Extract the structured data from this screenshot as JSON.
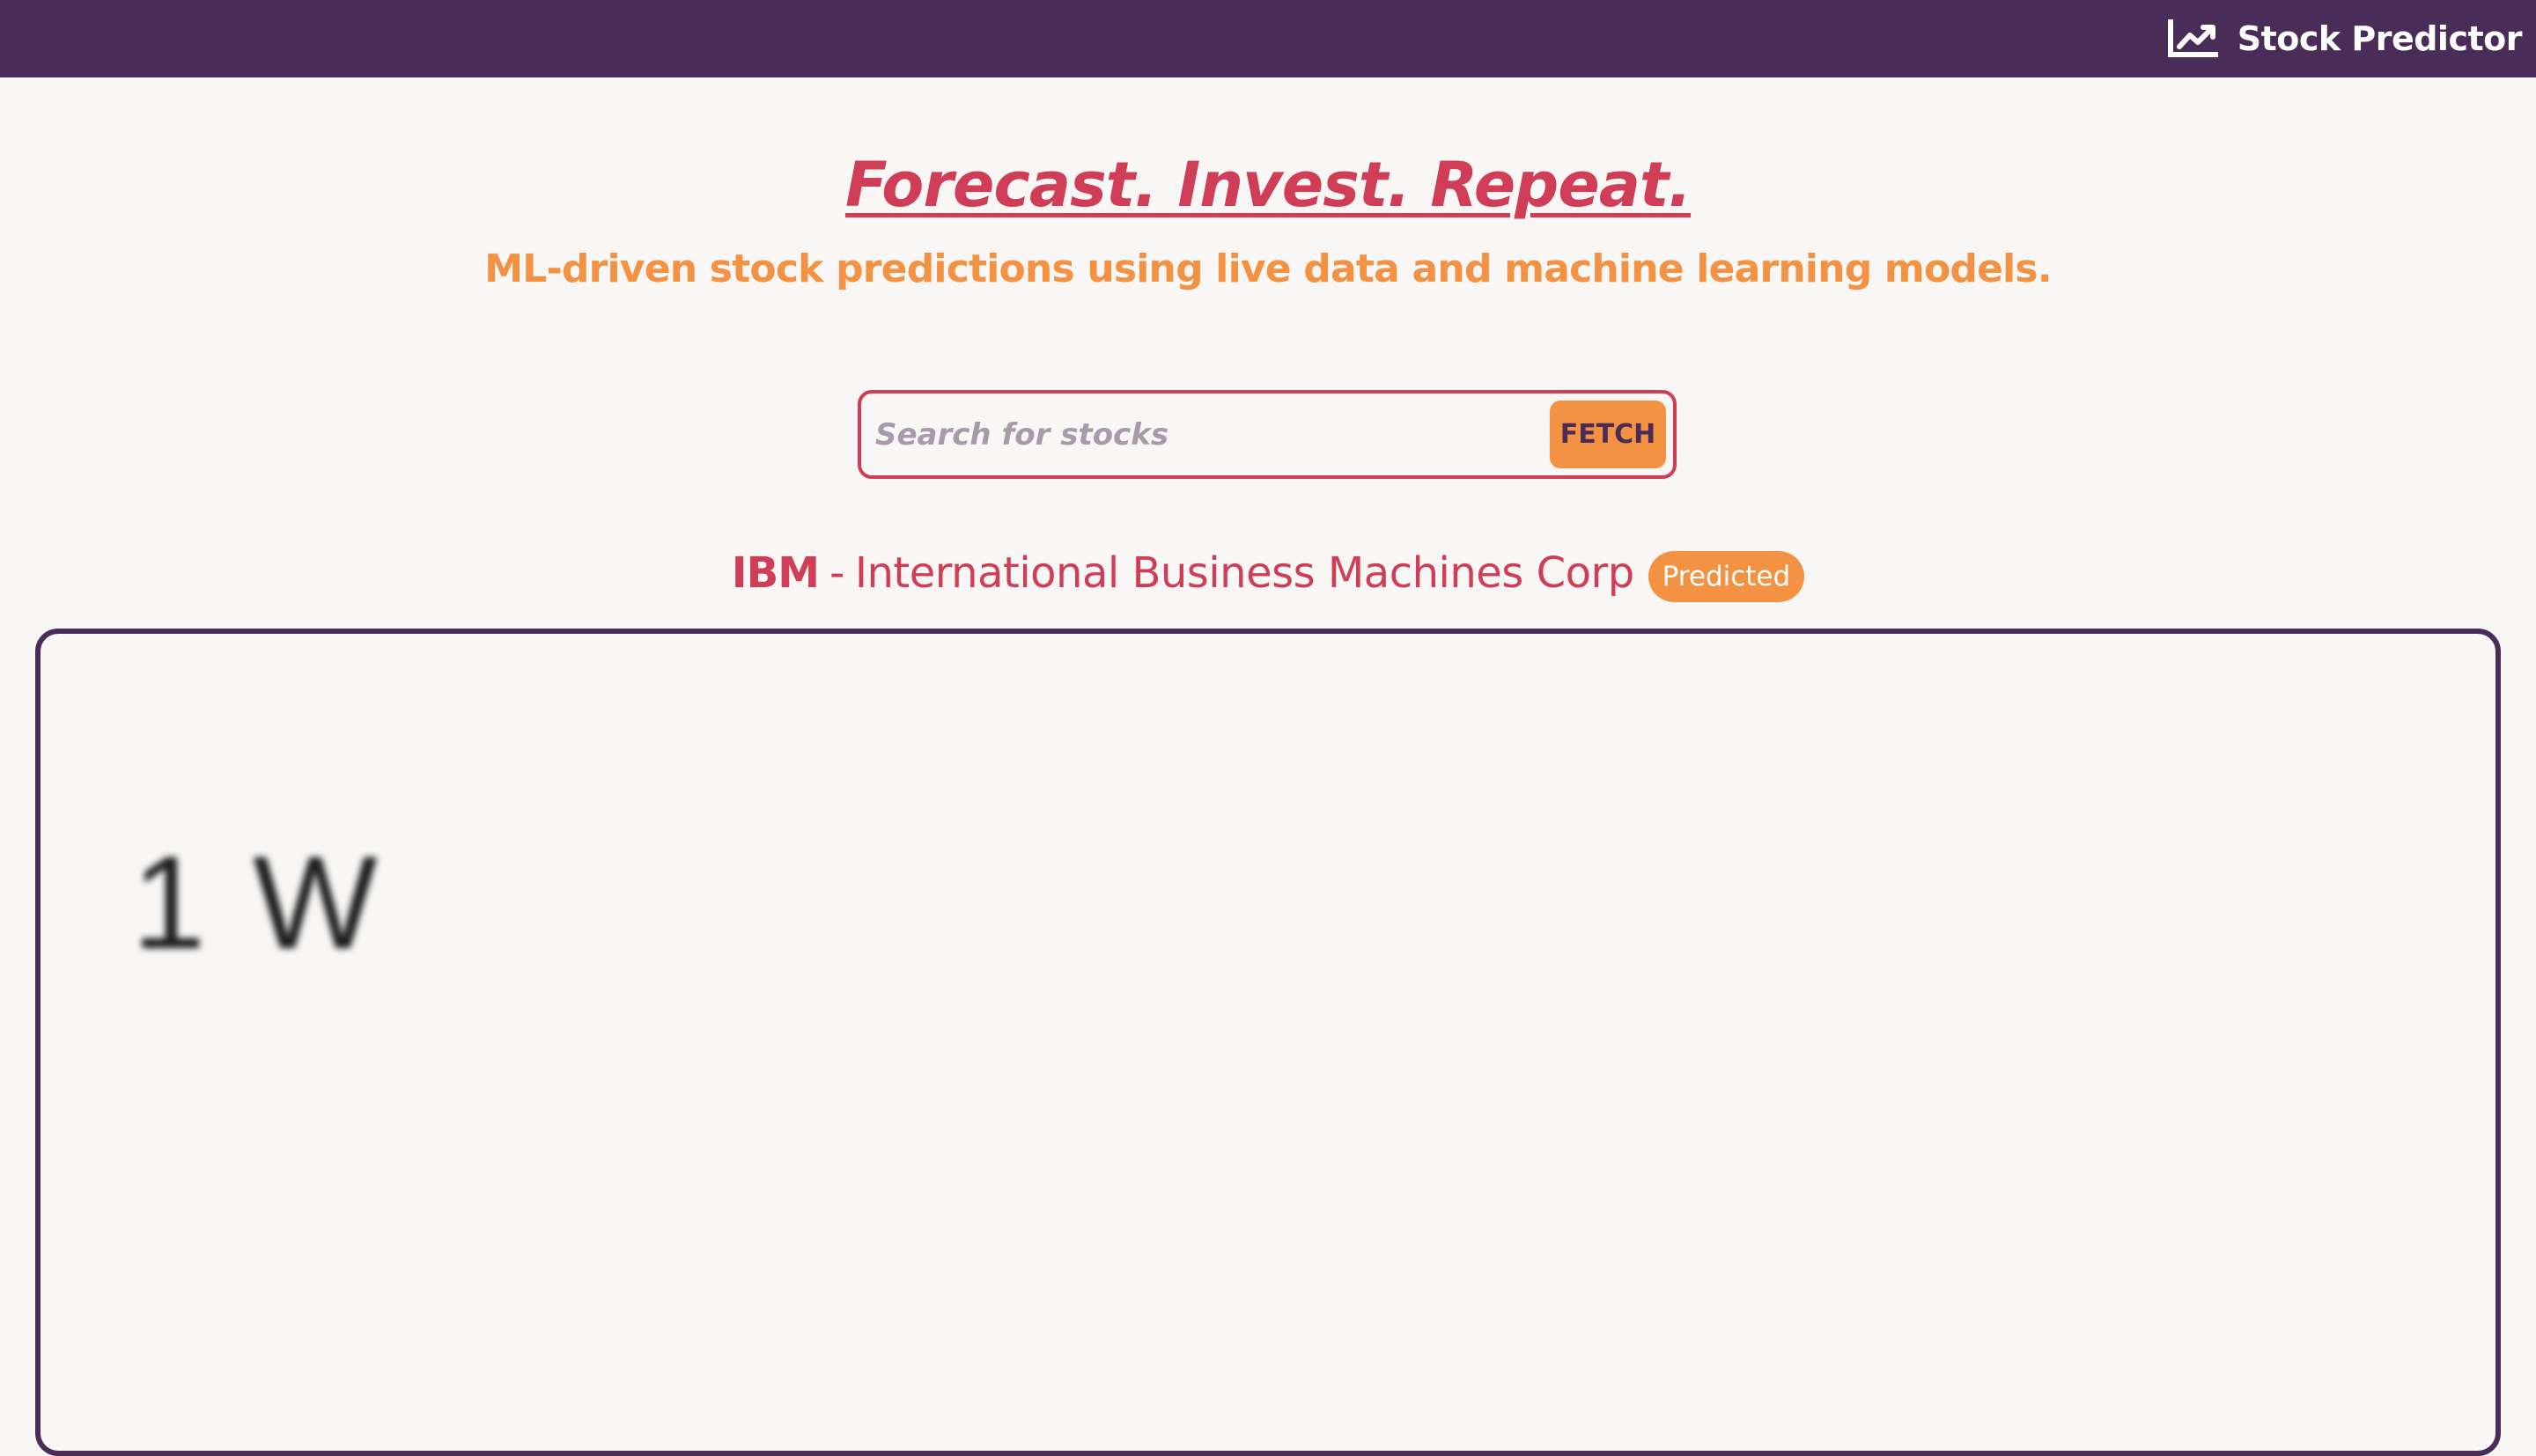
{
  "navbar": {
    "brand_icon": "chart-line-icon",
    "brand_text": "Stock Predictor",
    "background": "#4a2c58"
  },
  "hero": {
    "title": "Forecast. Invest. Repeat.",
    "subtitle": "ML-driven stock predictions using live data and machine learning models."
  },
  "search": {
    "placeholder": "Search for stocks",
    "value": "",
    "button_label": "FETCH"
  },
  "stock": {
    "ticker": "IBM",
    "separator": " - ",
    "company": "International Business Machines Corp",
    "badge": "Predicted"
  },
  "chart": {
    "range_label": "1 W"
  },
  "colors": {
    "primary": "#cf3e56",
    "accent": "#f39242",
    "dark": "#4a2c58",
    "background": "#f8f7f6"
  }
}
